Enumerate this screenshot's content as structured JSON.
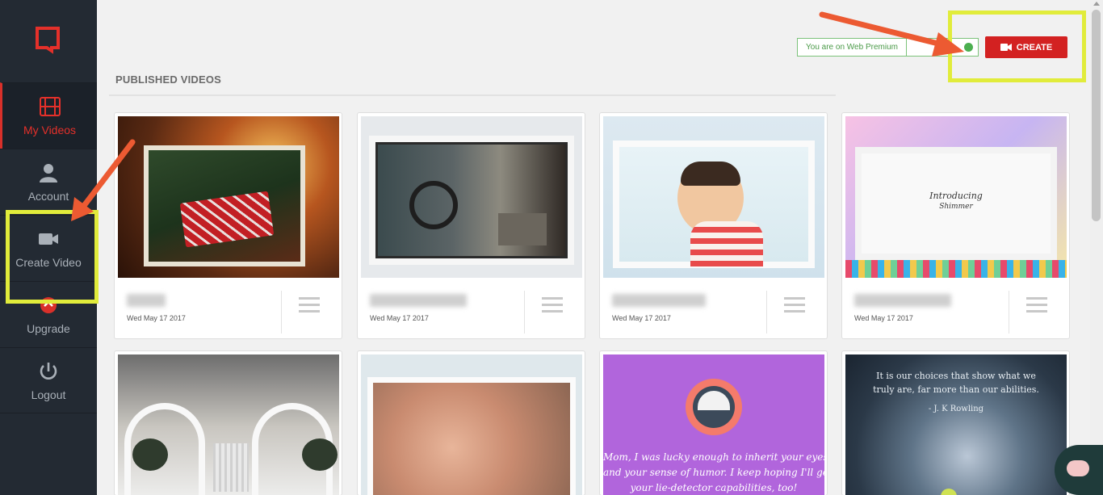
{
  "sidebar": {
    "logo_icon": "brand-logo-icon",
    "items": [
      {
        "label": "My Videos",
        "icon": "film-icon",
        "active": true
      },
      {
        "label": "Account",
        "icon": "user-icon",
        "active": false
      },
      {
        "label": "Create Video",
        "icon": "video-camera-icon",
        "active": false
      },
      {
        "label": "Upgrade",
        "icon": "upgrade-icon",
        "active": false
      },
      {
        "label": "Logout",
        "icon": "power-icon",
        "active": false
      }
    ]
  },
  "header": {
    "plan_badge": "You are on Web Premium",
    "create_label": "CREATE",
    "create_color": "#d32121"
  },
  "main": {
    "section_title": "PUBLISHED VIDEOS",
    "videos": [
      {
        "date": "Wed May 17 2017",
        "thumb": "christmas-gift-thumbnail"
      },
      {
        "date": "Wed May 17 2017",
        "thumb": "motorcycle-street-thumbnail"
      },
      {
        "date": "Wed May 17 2017",
        "thumb": "baby-thumbnail"
      },
      {
        "date": "Wed May 17 2017",
        "thumb": "introducing-shimmer-thumbnail",
        "thumb_text": [
          "Introducing",
          "Shimmer"
        ]
      },
      {
        "thumb": "interior-plants-thumbnail"
      },
      {
        "thumb": "sleeping-baby-thumbnail"
      },
      {
        "thumb": "mothers-day-quote-thumbnail",
        "thumb_text": [
          "Mom, I was lucky enough to inherit your eyes",
          "and your sense of humor. I keep hoping I'll get",
          "your lie-detector capabilities, too!"
        ]
      },
      {
        "thumb": "night-sky-quote-thumbnail",
        "thumb_text": [
          "It is our choices that show what we",
          "truly are, far more than our abilities.",
          "- J. K Rowling"
        ]
      }
    ]
  },
  "colors": {
    "sidebar_bg": "#232a33",
    "accent_red": "#d9302a",
    "highlight": "#e1ec3b",
    "arrow": "#ec5a32"
  }
}
